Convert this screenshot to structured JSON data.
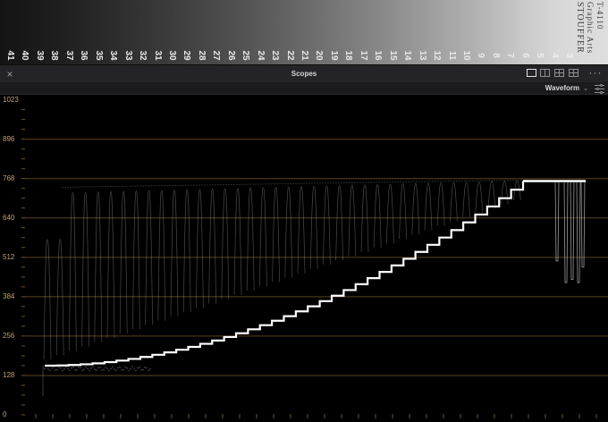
{
  "wedge": {
    "step_numbers": [
      "41",
      "40",
      "39",
      "38",
      "37",
      "36",
      "35",
      "34",
      "33",
      "32",
      "31",
      "30",
      "29",
      "28",
      "27",
      "26",
      "25",
      "24",
      "23",
      "22",
      "21",
      "20",
      "19",
      "18",
      "17",
      "16",
      "15",
      "14",
      "13",
      "12",
      "11",
      "10",
      "9",
      "8",
      "7",
      "6",
      "5",
      "4",
      "3"
    ],
    "brand_line1": "STOUFFER",
    "brand_line2": "Graphic Arts",
    "brand_line3": "T-4110"
  },
  "panel": {
    "title": "Scopes",
    "close_glyph": "×",
    "more_glyph": "···"
  },
  "toolbar": {
    "scope_type": "Waveform"
  },
  "scope": {
    "y_ticks": [
      "1023",
      "896",
      "768",
      "640",
      "512",
      "384",
      "256",
      "128",
      "0"
    ],
    "y_tick_values": [
      1023,
      896,
      768,
      640,
      512,
      384,
      256,
      128,
      0
    ],
    "max_value": 1023,
    "graticule_color": "#7a5a2e",
    "label_color": "#c8a070",
    "trace_color": "#ffffff"
  }
}
